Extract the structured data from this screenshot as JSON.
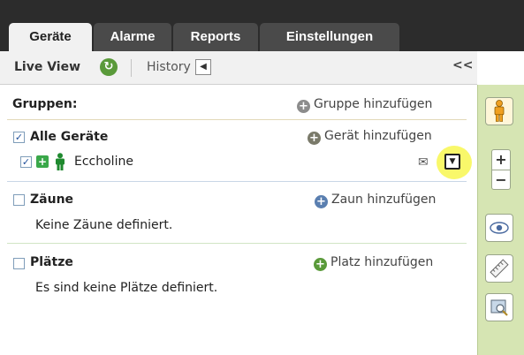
{
  "tabs": [
    {
      "label": "Geräte",
      "active": true
    },
    {
      "label": "Alarme",
      "active": false
    },
    {
      "label": "Reports",
      "active": false
    },
    {
      "label": "Einstellungen",
      "active": false
    }
  ],
  "subbar": {
    "live_view": "Live View",
    "history": "History",
    "collapse": "<<",
    "sync_glyph": "↻",
    "back_glyph": "◀"
  },
  "groups": {
    "heading": "Gruppen:",
    "add_group": "Gruppe hinzufügen"
  },
  "devices": {
    "all_label": "Alle Geräte",
    "all_checked": true,
    "add_device": "Gerät hinzufügen",
    "items": [
      {
        "name": "Eccholine",
        "checked": true
      }
    ]
  },
  "fences": {
    "label": "Zäune",
    "checked": false,
    "add": "Zaun hinzufügen",
    "empty": "Keine Zäune definiert."
  },
  "places": {
    "label": "Plätze",
    "checked": false,
    "add": "Platz hinzufügen",
    "empty": "Es sind keine Plätze definiert."
  },
  "toolbar": {
    "zoom_in": "+",
    "zoom_out": "−"
  },
  "colors": {
    "topbar": "#2c2c2c",
    "tab_inactive": "#4a4a4a",
    "accent_green": "#3aa84a",
    "sidebar": "#d6e5b3",
    "highlight": "#f9f86a"
  }
}
